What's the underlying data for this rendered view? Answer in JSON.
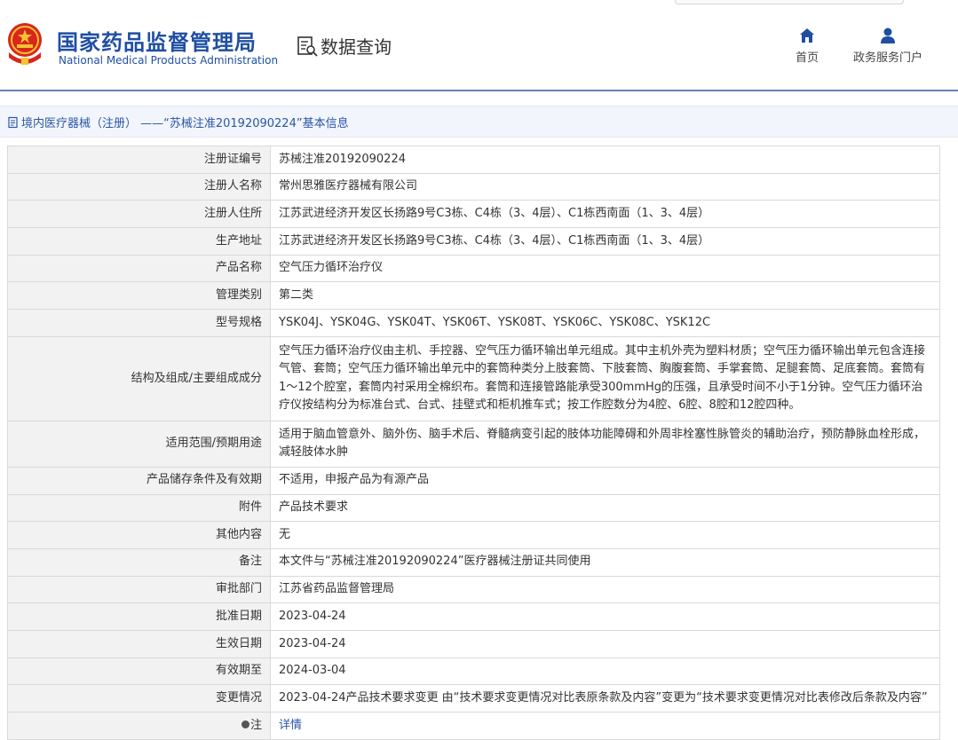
{
  "header": {
    "title_cn": "国家药品监督管理局",
    "title_en": "National Medical Products Administration",
    "query_label": "数据查询",
    "nav": [
      {
        "label": "首页",
        "icon": "home-icon"
      },
      {
        "label": "政务服务门户",
        "icon": "user-icon"
      }
    ]
  },
  "breadcrumb": {
    "icon": "document-icon",
    "text": "境内医疗器械（注册） ——“苏械注准20192090224”基本信息"
  },
  "colors": {
    "brand": "#1f4ea3",
    "link": "#2a56a5",
    "label_bg": "#f2f2f2",
    "crumb_bg": "#f2f5fb"
  },
  "table": {
    "rows": [
      {
        "label": "注册证编号",
        "value": "苏械注准20192090224"
      },
      {
        "label": "注册人名称",
        "value": "常州思雅医疗器械有限公司"
      },
      {
        "label": "注册人住所",
        "value": "江苏武进经济开发区长扬路9号C3栋、C4栋（3、4层）、C1栋西南面（1、3、4层）"
      },
      {
        "label": "生产地址",
        "value": "江苏武进经济开发区长扬路9号C3栋、C4栋（3、4层）、C1栋西南面（1、3、4层）"
      },
      {
        "label": "产品名称",
        "value": "空气压力循环治疗仪"
      },
      {
        "label": "管理类别",
        "value": "第二类"
      },
      {
        "label": "型号规格",
        "value": "YSK04J、YSK04G、YSK04T、YSK06T、YSK08T、YSK06C、YSK08C、YSK12C"
      },
      {
        "label": "结构及组成/主要组成成分",
        "value": "空气压力循环治疗仪由主机、手控器、空气压力循环输出单元组成。其中主机外壳为塑料材质；空气压力循环输出单元包含连接气管、套筒；空气压力循环输出单元中的套筒种类分上肢套筒、下肢套筒、胸腹套筒、手掌套筒、足腿套筒、足底套筒。套筒有1～12个腔室，套筒内衬采用全棉织布。套筒和连接管路能承受300mmHg的压强，且承受时间不小于1分钟。空气压力循环治疗仪按结构分为标准台式、台式、挂壁式和柜机推车式；按工作腔数分为4腔、6腔、8腔和12腔四种。"
      },
      {
        "label": "适用范围/预期用途",
        "value": "适用于脑血管意外、脑外伤、脑手术后、脊髓病变引起的肢体功能障碍和外周非栓塞性脉管炎的辅助治疗，预防静脉血栓形成，减轻肢体水肿"
      },
      {
        "label": "产品储存条件及有效期",
        "value": "不适用，申报产品为有源产品"
      },
      {
        "label": "附件",
        "value": "产品技术要求"
      },
      {
        "label": "其他内容",
        "value": "无"
      },
      {
        "label": "备注",
        "value": "本文件与“苏械注准20192090224”医疗器械注册证共同使用"
      },
      {
        "label": "审批部门",
        "value": "江苏省药品监督管理局"
      },
      {
        "label": "批准日期",
        "value": "2023-04-24"
      },
      {
        "label": "生效日期",
        "value": "2023-04-24"
      },
      {
        "label": "有效期至",
        "value": "2024-03-04"
      },
      {
        "label": "变更情况",
        "value": "2023-04-24产品技术要求变更 由“技术要求变更情况对比表原条款及内容”变更为“技术要求变更情况对比表修改后条款及内容”"
      },
      {
        "label": "注",
        "value": "详情",
        "icon": "lightbulb-icon"
      }
    ]
  }
}
